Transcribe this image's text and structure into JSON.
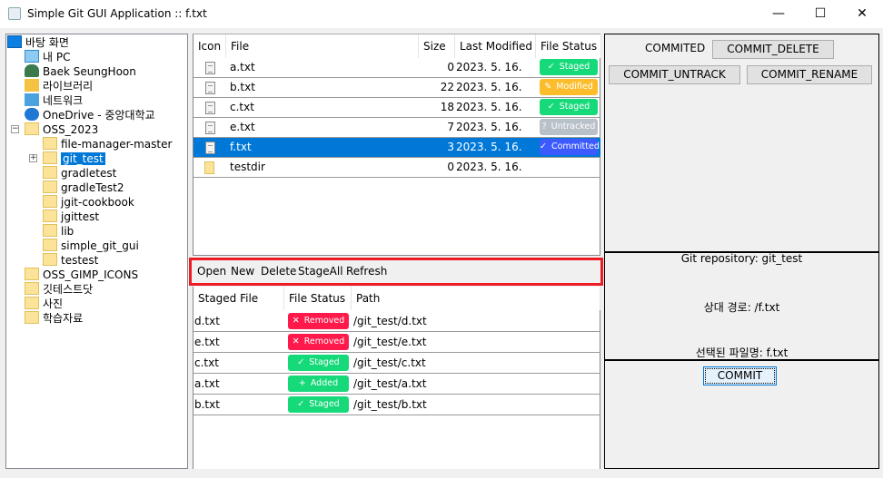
{
  "window": {
    "title": "Simple Git GUI Application :: f.txt",
    "minimize": "—",
    "maximize": "☐",
    "close": "✕"
  },
  "tree": {
    "root": "바탕 화면",
    "items": [
      "내 PC",
      "Baek SeungHoon",
      "라이브러리",
      "네트워크",
      "OneDrive - 중앙대학교",
      "OSS_2023"
    ],
    "oss_children": [
      "file-manager-master",
      "git_test",
      "gradletest",
      "gradleTest2",
      "jgit-cookbook",
      "jgittest",
      "lib",
      "simple_git_gui",
      "testest"
    ],
    "more": [
      "OSS_GIMP_ICONS",
      "깃테스트닷",
      "사진",
      "학습자료"
    ],
    "selected": "git_test"
  },
  "file_table": {
    "headers": [
      "Icon",
      "File",
      "Size",
      "Last Modified",
      "File Status"
    ],
    "rows": [
      {
        "file": "a.txt",
        "size": "0",
        "modified": "2023. 5. 16.",
        "status": "Staged",
        "icon": "✓",
        "color": "#16d97a",
        "type": "file"
      },
      {
        "file": "b.txt",
        "size": "22",
        "modified": "2023. 5. 16.",
        "status": "Modified",
        "icon": "✎",
        "color": "#fbbd2c",
        "type": "file"
      },
      {
        "file": "c.txt",
        "size": "18",
        "modified": "2023. 5. 16.",
        "status": "Staged",
        "icon": "✓",
        "color": "#16d97a",
        "type": "file"
      },
      {
        "file": "e.txt",
        "size": "7",
        "modified": "2023. 5. 16.",
        "status": "Untracked",
        "icon": "?",
        "color": "#b8c0c8",
        "type": "file"
      },
      {
        "file": "f.txt",
        "size": "3",
        "modified": "2023. 5. 16.",
        "status": "Committed",
        "icon": "✓",
        "color": "#3d5afe",
        "type": "file",
        "selected": true
      },
      {
        "file": "testdir",
        "size": "0",
        "modified": "2023. 5. 16.",
        "status": "",
        "type": "folder"
      }
    ]
  },
  "toolbar": {
    "open": "Open",
    "new": "New",
    "delete": "Delete",
    "stage_all": "StageAll",
    "refresh": "Refresh"
  },
  "staged_table": {
    "headers": [
      "Staged File",
      "File Status",
      "Path"
    ],
    "rows": [
      {
        "file": "d.txt",
        "status": "Removed",
        "icon": "✕",
        "color": "#ff1a4b",
        "path": "/git_test/d.txt"
      },
      {
        "file": "e.txt",
        "status": "Removed",
        "icon": "✕",
        "color": "#ff1a4b",
        "path": "/git_test/e.txt"
      },
      {
        "file": "c.txt",
        "status": "Staged",
        "icon": "✓",
        "color": "#16d97a",
        "path": "/git_test/c.txt"
      },
      {
        "file": "a.txt",
        "status": "Added",
        "icon": "+",
        "color": "#16d97a",
        "path": "/git_test/a.txt"
      },
      {
        "file": "b.txt",
        "status": "Staged",
        "icon": "✓",
        "color": "#16d97a",
        "path": "/git_test/b.txt"
      }
    ]
  },
  "right": {
    "committed_label": "COMMITED",
    "commit_delete": "COMMIT_DELETE",
    "commit_untrack": "COMMIT_UNTRACK",
    "commit_rename": "COMMIT_RENAME",
    "repo": "Git repository: git_test",
    "relative_path": "상대 경로: /f.txt",
    "selected_file": "선택된 파일명: f.txt",
    "commit": "COMMIT"
  }
}
